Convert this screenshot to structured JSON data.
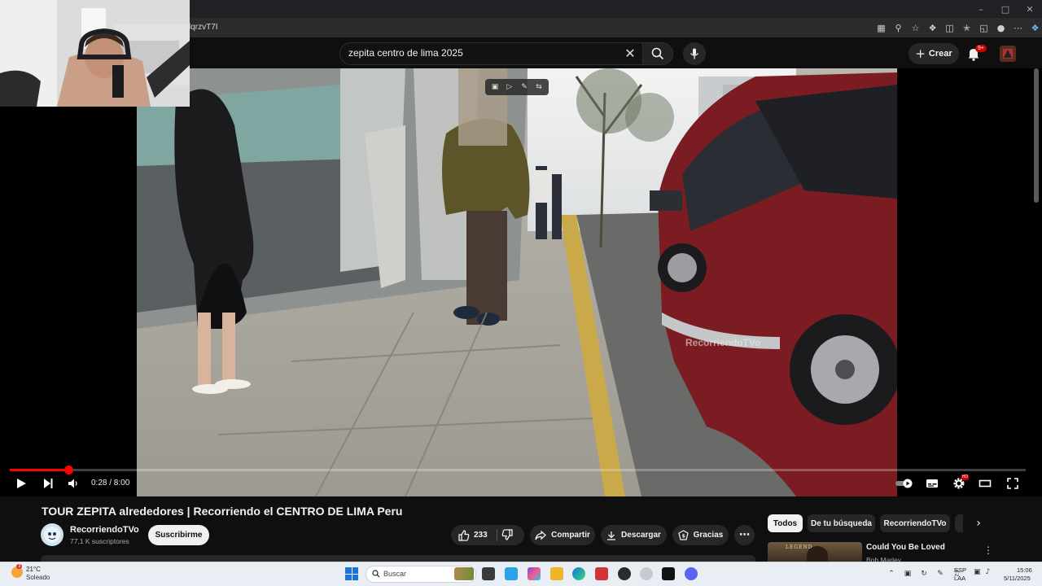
{
  "browser": {
    "url_fragment": "lqrzvT7I"
  },
  "header": {
    "search_value": "zepita centro de lima 2025",
    "create_label": "Crear",
    "notifications_badge": "9+"
  },
  "video": {
    "watermark": "RecorriendoTVo",
    "current_time": "0:28",
    "duration": "8:00",
    "time_display": "0:28 / 8:00",
    "progress_fraction": 0.058,
    "settings_badge": "HD"
  },
  "info": {
    "title": "TOUR ZEPITA alrededores | Recorriendo el CENTRO DE LIMA Peru",
    "channel_name": "RecorriendoTVo",
    "channel_subs": "77,1 K suscriptores",
    "subscribe_label": "Suscribirme",
    "likes": "233",
    "share_label": "Compartir",
    "download_label": "Descargar",
    "thanks_label": "Gracias"
  },
  "chips": [
    "Todos",
    "De tu búsqueda",
    "RecorriendoTVo"
  ],
  "recommendation": {
    "title": "Could You Be Loved",
    "channel": "Bob Marley",
    "thumb_text": "LEGEND"
  },
  "taskbar": {
    "weather_badge": "3",
    "temperature": "21°C",
    "weather_desc": "Soleado",
    "search_placeholder": "Buscar",
    "lang_line1": "ESP",
    "lang_line2": "LAA",
    "time": "15:06",
    "date": "5/11/2025"
  },
  "colors": {
    "accent": "#ff0000",
    "background": "#0f0f0f"
  }
}
